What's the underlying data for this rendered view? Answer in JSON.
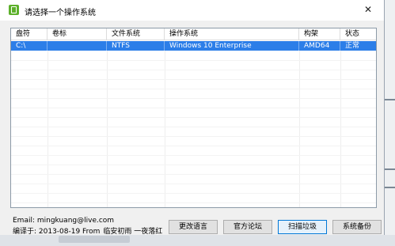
{
  "window": {
    "title": "请选择一个操作系统",
    "close_glyph": "✕"
  },
  "list": {
    "columns": [
      "盘符",
      "卷标",
      "文件系统",
      "操作系统",
      "构架",
      "状态"
    ],
    "rows": [
      {
        "drive": "C:\\",
        "volume": "",
        "filesystem": "NTFS",
        "os": "Windows 10 Enterprise",
        "arch": "AMD64",
        "status": "正常",
        "selected": true
      }
    ]
  },
  "footer": {
    "email": "Email: mingkuang@live.com",
    "compiled_label": "编译于: 2013-08-19 From",
    "compiled_author": "临安初雨 一夜落红",
    "buttons": {
      "change_language": "更改语言",
      "official_forum": "官方论坛",
      "clean_junk": "扫描垃圾",
      "system_backup": "系统备份"
    }
  },
  "colors": {
    "selection": "#2c7ee8",
    "app_icon": "#5db02b",
    "focus_border": "#0078d7"
  },
  "icons": {
    "app": "app-icon",
    "close": "close-icon"
  }
}
